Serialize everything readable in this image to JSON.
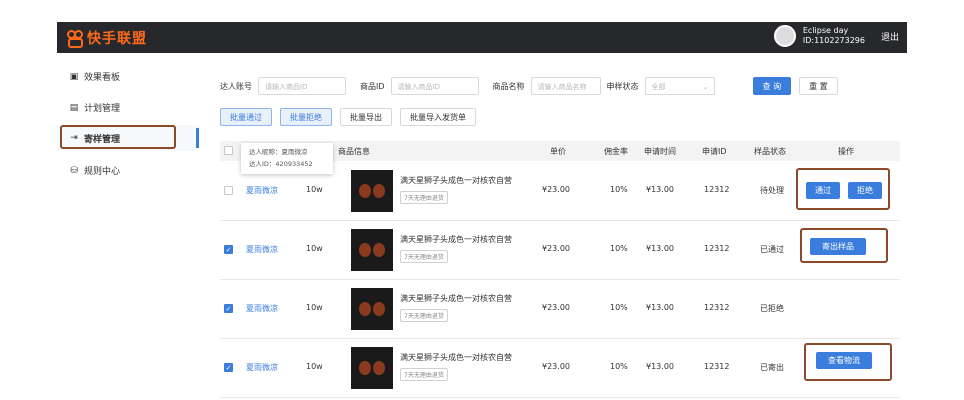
{
  "topbar": {
    "logo_text": "快手联盟",
    "username": "Eclipse day",
    "user_id": "ID:1102273296",
    "logout": "退出"
  },
  "sidebar": {
    "items": [
      {
        "label": "效果看板",
        "icon": "dashboard-icon"
      },
      {
        "label": "计划管理",
        "icon": "plan-icon"
      },
      {
        "label": "寄样管理",
        "icon": "sample-icon",
        "active": true
      },
      {
        "label": "规则中心",
        "icon": "rules-icon"
      }
    ]
  },
  "filters": {
    "talent_label": "达人账号",
    "talent_placeholder": "请输入商品ID",
    "product_id_label": "商品ID",
    "product_id_placeholder": "请输入商品ID",
    "product_name_label": "商品名称",
    "product_name_placeholder": "请输入商品名称",
    "status_label": "申样状态",
    "status_value": "全部",
    "query_btn": "查 询",
    "reset_btn": "重 置"
  },
  "actions": {
    "batch_pass": "批量通过",
    "batch_reject": "批量拒绝",
    "batch_export": "批量导出",
    "batch_import": "批量导入发货单"
  },
  "table": {
    "headers": {
      "product_info": "商品信息",
      "price": "单价",
      "commission": "佣金率",
      "apply_time": "申请时间",
      "apply_id": "申请ID",
      "status": "样品状态",
      "operation": "操作"
    },
    "rows": [
      {
        "checked": false,
        "talent": "夏雨微凉",
        "fans": "10w",
        "name": "满天星狮子头成色一对核农自营",
        "tag": "7天无理由退货",
        "price": "¥23.00",
        "commission": "10%",
        "time": "¥13.00",
        "id": "12312",
        "status": "待处理",
        "ops": [
          "通过",
          "拒绝"
        ]
      },
      {
        "checked": true,
        "talent": "夏雨微凉",
        "fans": "10w",
        "name": "满天星狮子头成色一对核农自营",
        "tag": "7天无理由退货",
        "price": "¥23.00",
        "commission": "10%",
        "time": "¥13.00",
        "id": "12312",
        "status": "已通过",
        "ops": [
          "寄出样品"
        ]
      },
      {
        "checked": true,
        "talent": "夏雨微凉",
        "fans": "10w",
        "name": "满天星狮子头成色一对核农自营",
        "tag": "7天无理由退货",
        "price": "¥23.00",
        "commission": "10%",
        "time": "¥13.00",
        "id": "12312",
        "status": "已拒绝",
        "ops": []
      },
      {
        "checked": true,
        "talent": "夏雨微凉",
        "fans": "10w",
        "name": "满天星狮子头成色一对核农自营",
        "tag": "7天无理由退货",
        "price": "¥23.00",
        "commission": "10%",
        "time": "¥13.00",
        "id": "12312",
        "status": "已寄出",
        "ops": [
          "查看物流"
        ]
      }
    ]
  },
  "tooltip": {
    "line1": "达人昵称：夏雨微凉",
    "line2": "达人ID：420933452"
  },
  "colors": {
    "accent": "#3b7ddd",
    "brand": "#ff6a1a",
    "highlight_border": "#8b4a2c"
  }
}
